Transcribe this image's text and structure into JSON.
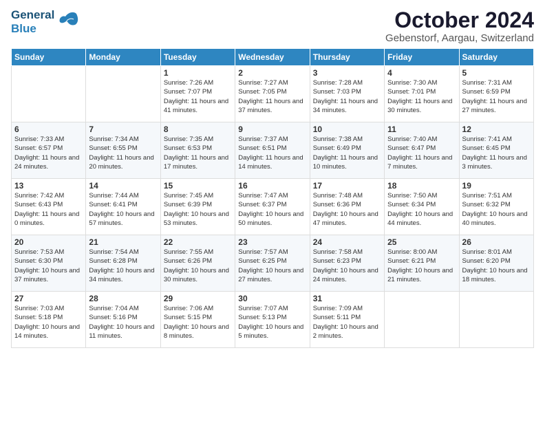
{
  "header": {
    "logo_general": "General",
    "logo_blue": "Blue",
    "title": "October 2024",
    "subtitle": "Gebenstorf, Aargau, Switzerland"
  },
  "days_of_week": [
    "Sunday",
    "Monday",
    "Tuesday",
    "Wednesday",
    "Thursday",
    "Friday",
    "Saturday"
  ],
  "weeks": [
    [
      {
        "day": "",
        "sunrise": "",
        "sunset": "",
        "daylight": ""
      },
      {
        "day": "",
        "sunrise": "",
        "sunset": "",
        "daylight": ""
      },
      {
        "day": "1",
        "sunrise": "Sunrise: 7:26 AM",
        "sunset": "Sunset: 7:07 PM",
        "daylight": "Daylight: 11 hours and 41 minutes."
      },
      {
        "day": "2",
        "sunrise": "Sunrise: 7:27 AM",
        "sunset": "Sunset: 7:05 PM",
        "daylight": "Daylight: 11 hours and 37 minutes."
      },
      {
        "day": "3",
        "sunrise": "Sunrise: 7:28 AM",
        "sunset": "Sunset: 7:03 PM",
        "daylight": "Daylight: 11 hours and 34 minutes."
      },
      {
        "day": "4",
        "sunrise": "Sunrise: 7:30 AM",
        "sunset": "Sunset: 7:01 PM",
        "daylight": "Daylight: 11 hours and 30 minutes."
      },
      {
        "day": "5",
        "sunrise": "Sunrise: 7:31 AM",
        "sunset": "Sunset: 6:59 PM",
        "daylight": "Daylight: 11 hours and 27 minutes."
      }
    ],
    [
      {
        "day": "6",
        "sunrise": "Sunrise: 7:33 AM",
        "sunset": "Sunset: 6:57 PM",
        "daylight": "Daylight: 11 hours and 24 minutes."
      },
      {
        "day": "7",
        "sunrise": "Sunrise: 7:34 AM",
        "sunset": "Sunset: 6:55 PM",
        "daylight": "Daylight: 11 hours and 20 minutes."
      },
      {
        "day": "8",
        "sunrise": "Sunrise: 7:35 AM",
        "sunset": "Sunset: 6:53 PM",
        "daylight": "Daylight: 11 hours and 17 minutes."
      },
      {
        "day": "9",
        "sunrise": "Sunrise: 7:37 AM",
        "sunset": "Sunset: 6:51 PM",
        "daylight": "Daylight: 11 hours and 14 minutes."
      },
      {
        "day": "10",
        "sunrise": "Sunrise: 7:38 AM",
        "sunset": "Sunset: 6:49 PM",
        "daylight": "Daylight: 11 hours and 10 minutes."
      },
      {
        "day": "11",
        "sunrise": "Sunrise: 7:40 AM",
        "sunset": "Sunset: 6:47 PM",
        "daylight": "Daylight: 11 hours and 7 minutes."
      },
      {
        "day": "12",
        "sunrise": "Sunrise: 7:41 AM",
        "sunset": "Sunset: 6:45 PM",
        "daylight": "Daylight: 11 hours and 3 minutes."
      }
    ],
    [
      {
        "day": "13",
        "sunrise": "Sunrise: 7:42 AM",
        "sunset": "Sunset: 6:43 PM",
        "daylight": "Daylight: 11 hours and 0 minutes."
      },
      {
        "day": "14",
        "sunrise": "Sunrise: 7:44 AM",
        "sunset": "Sunset: 6:41 PM",
        "daylight": "Daylight: 10 hours and 57 minutes."
      },
      {
        "day": "15",
        "sunrise": "Sunrise: 7:45 AM",
        "sunset": "Sunset: 6:39 PM",
        "daylight": "Daylight: 10 hours and 53 minutes."
      },
      {
        "day": "16",
        "sunrise": "Sunrise: 7:47 AM",
        "sunset": "Sunset: 6:37 PM",
        "daylight": "Daylight: 10 hours and 50 minutes."
      },
      {
        "day": "17",
        "sunrise": "Sunrise: 7:48 AM",
        "sunset": "Sunset: 6:36 PM",
        "daylight": "Daylight: 10 hours and 47 minutes."
      },
      {
        "day": "18",
        "sunrise": "Sunrise: 7:50 AM",
        "sunset": "Sunset: 6:34 PM",
        "daylight": "Daylight: 10 hours and 44 minutes."
      },
      {
        "day": "19",
        "sunrise": "Sunrise: 7:51 AM",
        "sunset": "Sunset: 6:32 PM",
        "daylight": "Daylight: 10 hours and 40 minutes."
      }
    ],
    [
      {
        "day": "20",
        "sunrise": "Sunrise: 7:53 AM",
        "sunset": "Sunset: 6:30 PM",
        "daylight": "Daylight: 10 hours and 37 minutes."
      },
      {
        "day": "21",
        "sunrise": "Sunrise: 7:54 AM",
        "sunset": "Sunset: 6:28 PM",
        "daylight": "Daylight: 10 hours and 34 minutes."
      },
      {
        "day": "22",
        "sunrise": "Sunrise: 7:55 AM",
        "sunset": "Sunset: 6:26 PM",
        "daylight": "Daylight: 10 hours and 30 minutes."
      },
      {
        "day": "23",
        "sunrise": "Sunrise: 7:57 AM",
        "sunset": "Sunset: 6:25 PM",
        "daylight": "Daylight: 10 hours and 27 minutes."
      },
      {
        "day": "24",
        "sunrise": "Sunrise: 7:58 AM",
        "sunset": "Sunset: 6:23 PM",
        "daylight": "Daylight: 10 hours and 24 minutes."
      },
      {
        "day": "25",
        "sunrise": "Sunrise: 8:00 AM",
        "sunset": "Sunset: 6:21 PM",
        "daylight": "Daylight: 10 hours and 21 minutes."
      },
      {
        "day": "26",
        "sunrise": "Sunrise: 8:01 AM",
        "sunset": "Sunset: 6:20 PM",
        "daylight": "Daylight: 10 hours and 18 minutes."
      }
    ],
    [
      {
        "day": "27",
        "sunrise": "Sunrise: 7:03 AM",
        "sunset": "Sunset: 5:18 PM",
        "daylight": "Daylight: 10 hours and 14 minutes."
      },
      {
        "day": "28",
        "sunrise": "Sunrise: 7:04 AM",
        "sunset": "Sunset: 5:16 PM",
        "daylight": "Daylight: 10 hours and 11 minutes."
      },
      {
        "day": "29",
        "sunrise": "Sunrise: 7:06 AM",
        "sunset": "Sunset: 5:15 PM",
        "daylight": "Daylight: 10 hours and 8 minutes."
      },
      {
        "day": "30",
        "sunrise": "Sunrise: 7:07 AM",
        "sunset": "Sunset: 5:13 PM",
        "daylight": "Daylight: 10 hours and 5 minutes."
      },
      {
        "day": "31",
        "sunrise": "Sunrise: 7:09 AM",
        "sunset": "Sunset: 5:11 PM",
        "daylight": "Daylight: 10 hours and 2 minutes."
      },
      {
        "day": "",
        "sunrise": "",
        "sunset": "",
        "daylight": ""
      },
      {
        "day": "",
        "sunrise": "",
        "sunset": "",
        "daylight": ""
      }
    ]
  ]
}
